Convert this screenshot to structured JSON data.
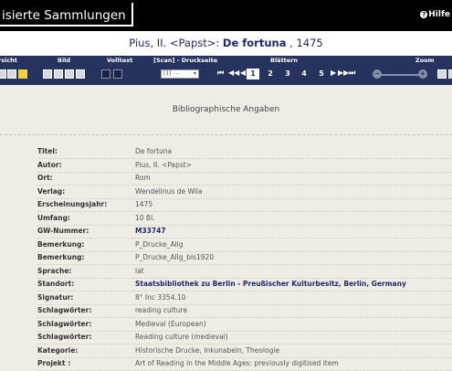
{
  "header": {
    "logo_text": "isierte Sammlungen",
    "help_label": "Hilfe"
  },
  "title": {
    "author": "Pius, II. <Papst>: ",
    "work": "De fortuna",
    "year": " , 1475"
  },
  "toolbar": {
    "groups": [
      "rsicht",
      "Bild",
      "Volltext",
      "[Scan] - Druckseite",
      "Blättern",
      "Zoom"
    ],
    "select_value": "[1] - -",
    "pages": [
      "1",
      "2",
      "3",
      "4",
      "5"
    ],
    "active_page": "1",
    "nav_first": "⏮",
    "nav_prev": "◀◀",
    "nav_back": "◀",
    "nav_next": "▶",
    "nav_fwd": "▶▶",
    "nav_last": "⏭"
  },
  "section_title": "Bibliographische Angaben",
  "fields": [
    {
      "k": "Titel:",
      "v": "De fortuna"
    },
    {
      "k": "Autor:",
      "v": "Pius, II. <Papst>"
    },
    {
      "k": "Ort:",
      "v": "Rom"
    },
    {
      "k": "Verlag:",
      "v": "Wendelinus de Wila"
    },
    {
      "k": "Erscheinungsjahr:",
      "v": "1475"
    },
    {
      "k": "Umfang:",
      "v": "10 Bl."
    },
    {
      "k": "GW-Nummer:",
      "v": "M33747"
    },
    {
      "k": "Bemerkung:",
      "v": "P_Drucke_Allg"
    },
    {
      "k": "Bemerkung:",
      "v": "P_Drucke_Allg_bis1920"
    },
    {
      "k": "Sprache:",
      "v": "lat"
    },
    {
      "k": "Standort:",
      "v": "Staatsbibliothek zu Berlin - Preußischer Kulturbesitz, Berlin, Germany"
    },
    {
      "k": "Signatur:",
      "v": "8° Inc 3354.10"
    },
    {
      "k": "Schlagwörter:",
      "v": "reading culture"
    },
    {
      "k": "Schlagwörter:",
      "v": "Medieval (European)"
    },
    {
      "k": "Schlagwörter:",
      "v": "Reading culture (medieval)"
    },
    {
      "k": "Kategorie:",
      "v": "Historische Drucke, Inkunabeln, Theologie"
    },
    {
      "k": "Projekt :",
      "v": "Art of Reading in the Middle Ages: previously digitised item"
    }
  ]
}
